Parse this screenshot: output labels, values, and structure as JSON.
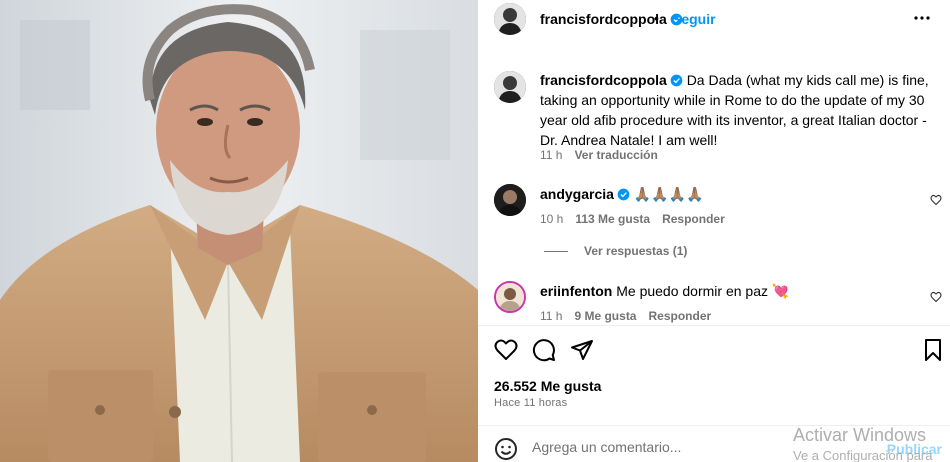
{
  "post": {
    "username": "francisfordcoppola",
    "separator": "•",
    "follow_label": "Seguir",
    "caption_author": "francisfordcoppola",
    "caption_text": "Da Dada (what my kids call me) is fine, taking an opportunity while in Rome to do the update of my 30 year old afib procedure with its inventor, a great Italian doctor - Dr. Andrea Natale! I am well!",
    "caption_time": "11 h",
    "translate_label": "Ver traducción",
    "likes": "26.552 Me gusta",
    "posted_ago": "Hace 11 horas"
  },
  "comments": [
    {
      "username": "andygarcia",
      "text": "🙏🏽🙏🏽🙏🏽🙏🏽",
      "time": "10 h",
      "likes": "113 Me gusta",
      "reply_label": "Responder",
      "view_replies": "Ver respuestas (1)"
    },
    {
      "username": "eriinfenton",
      "text": "Me puedo dormir en paz 💘",
      "time": "11 h",
      "likes": "9 Me gusta",
      "reply_label": "Responder"
    }
  ],
  "composer": {
    "placeholder": "Agrega un comentario...",
    "publish_label": "Publicar"
  },
  "watermark": {
    "line1": "Activar Windows",
    "line2": "Ve a Configuración para activar Windows."
  },
  "colors": {
    "accent": "#0095f6",
    "secondary_text": "#737373",
    "jacket": "#c8a27a"
  },
  "icons": [
    "more-icon",
    "heart-icon",
    "comment-icon",
    "share-icon",
    "bookmark-icon",
    "emoji-icon",
    "verified-icon"
  ]
}
